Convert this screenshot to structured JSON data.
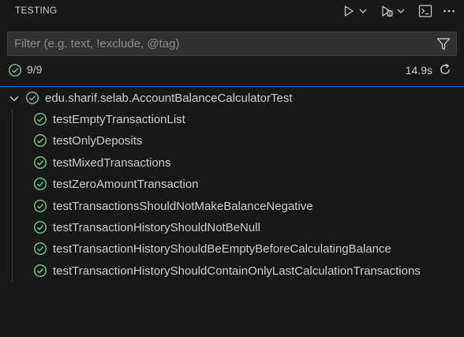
{
  "header": {
    "title": "TESTING",
    "actions": [
      {
        "name": "run-tests-icon"
      },
      {
        "name": "debug-tests-icon"
      },
      {
        "name": "terminal-icon"
      },
      {
        "name": "more-actions-icon"
      }
    ]
  },
  "filter": {
    "placeholder": "Filter (e.g. text, !exclude, @tag)",
    "value": "",
    "icon": "filter-icon"
  },
  "summary": {
    "count": "9/9",
    "duration": "14.9s",
    "status_icon": "passed-icon",
    "rerun_icon": "refresh-icon"
  },
  "colors": {
    "background": "#181818",
    "pass": "#73c991",
    "accent": "#0078d4",
    "text": "#cccccc",
    "input_bg": "#313131"
  },
  "tree": {
    "suite": {
      "label": "edu.sharif.selab.AccountBalanceCalculatorTest",
      "status": "passed",
      "expanded": true
    },
    "tests": [
      {
        "label": "testEmptyTransactionList",
        "status": "passed"
      },
      {
        "label": "testOnlyDeposits",
        "status": "passed"
      },
      {
        "label": "testMixedTransactions",
        "status": "passed"
      },
      {
        "label": "testZeroAmountTransaction",
        "status": "passed"
      },
      {
        "label": "testTransactionsShouldNotMakeBalanceNegative",
        "status": "passed"
      },
      {
        "label": "testTransactionHistoryShouldNotBeNull",
        "status": "passed"
      },
      {
        "label": "testTransactionHistoryShouldBeEmptyBeforeCalculatingBalance",
        "status": "passed"
      },
      {
        "label": "testTransactionHistoryShouldContainOnlyLastCalculationTransactions",
        "status": "passed"
      }
    ]
  }
}
